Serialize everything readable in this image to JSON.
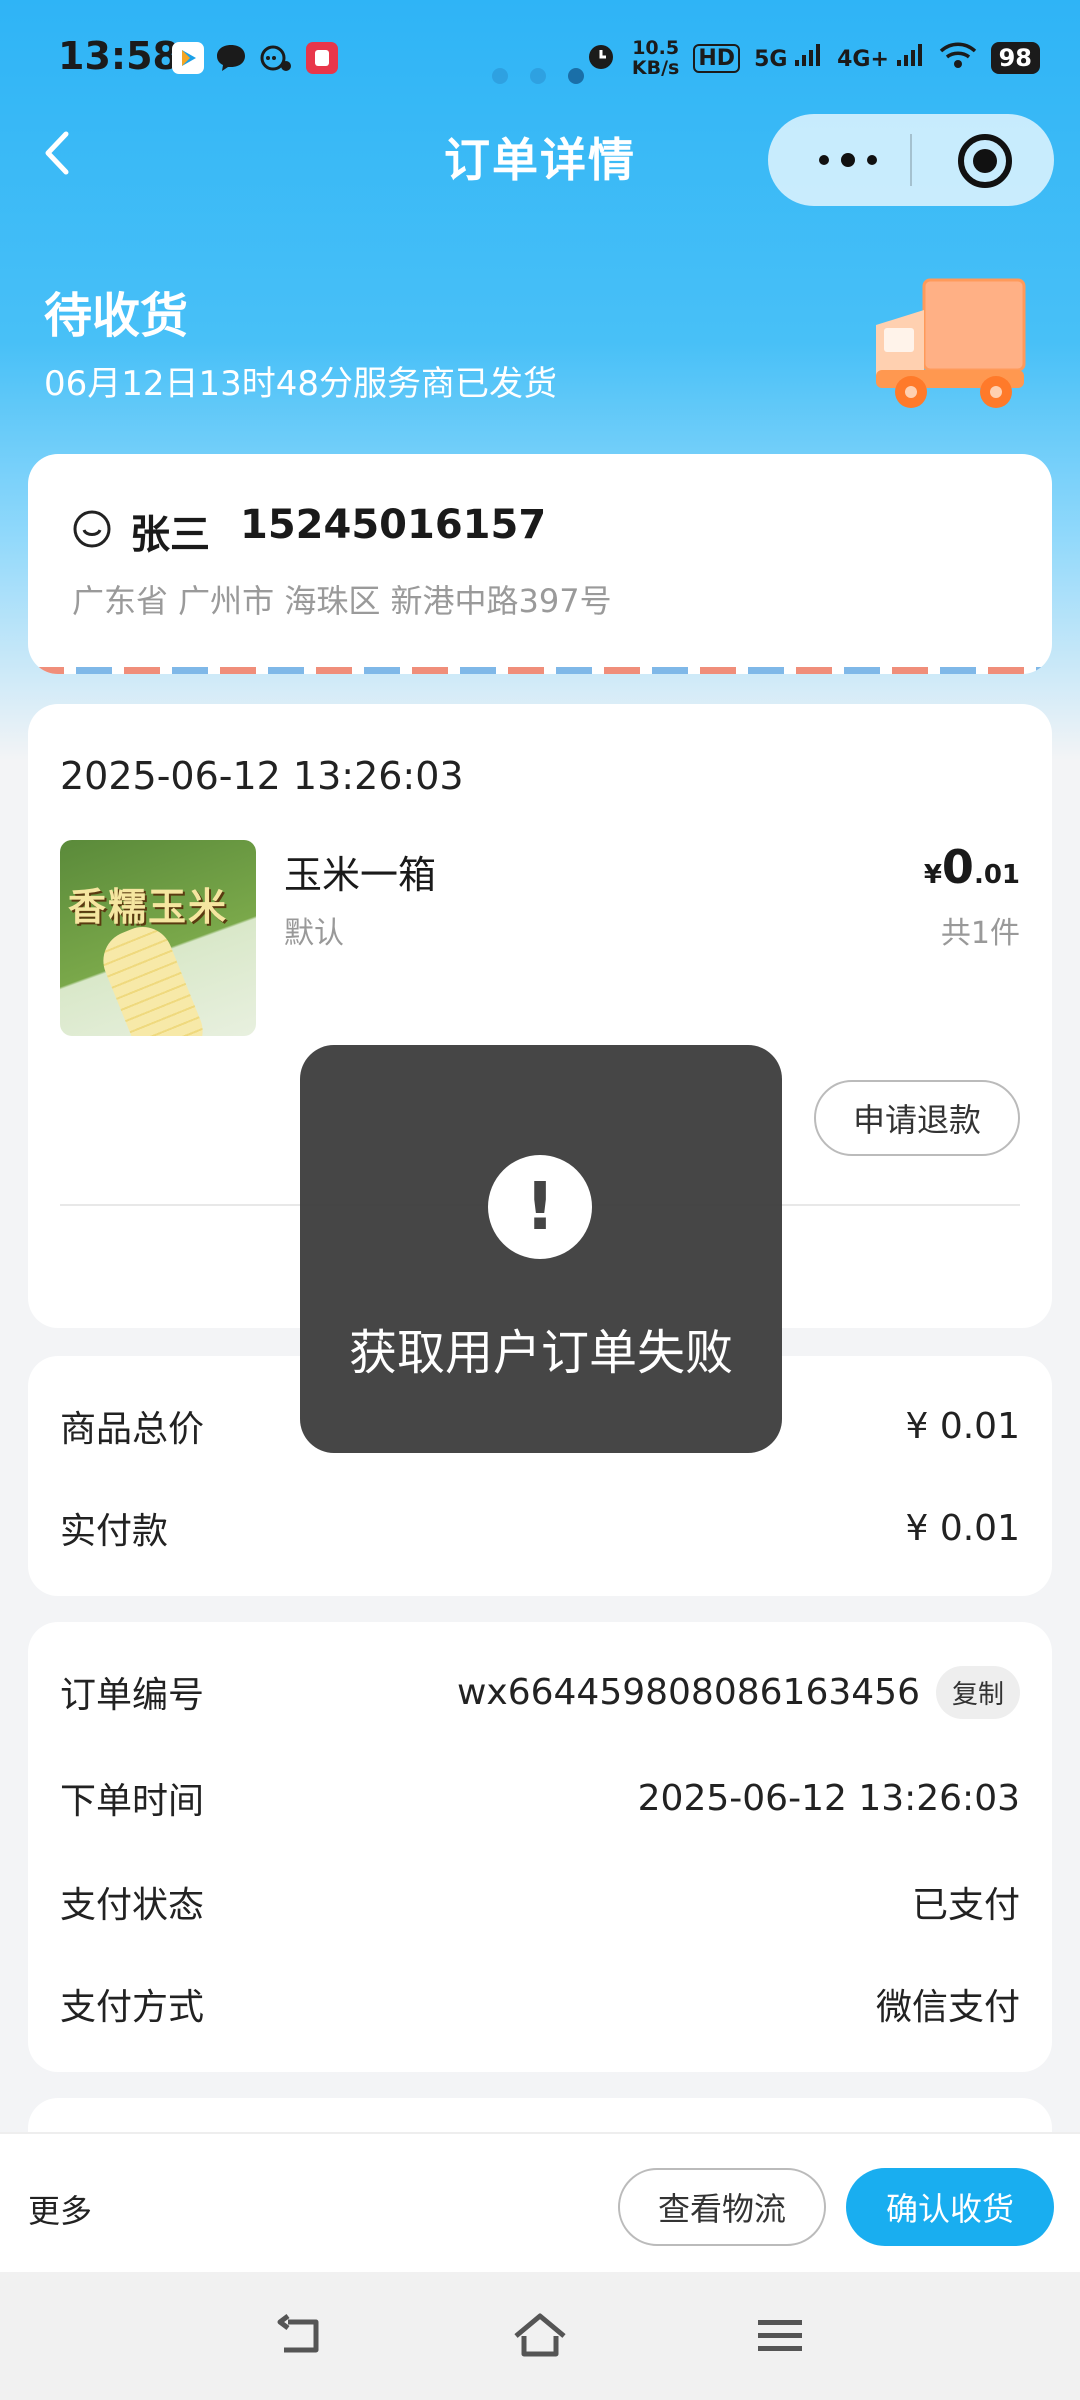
{
  "status_bar": {
    "time": "13:58",
    "net_speed_value": "10.5",
    "net_speed_unit": "KB/s",
    "hd_label": "HD",
    "signal_5g": "5G",
    "signal_4g": "4G+",
    "battery": "98"
  },
  "nav": {
    "title": "订单详情"
  },
  "order_status": {
    "title": "待收货",
    "subtitle": "06月12日13时48分服务商已发货"
  },
  "address": {
    "name": "张三",
    "phone": "15245016157",
    "detail": "广东省 广州市 海珠区 新港中路397号"
  },
  "goods": {
    "order_time": "2025-06-12 13:26:03",
    "image_text": "香糯玉米",
    "name": "玉米一箱",
    "spec": "默认",
    "price_symbol": "¥",
    "price_int": "0",
    "price_dec": ".01",
    "quantity": "共1件",
    "refund_label": "申请退款"
  },
  "price_summary": {
    "rows": [
      {
        "label": "商品总价",
        "value": "¥ 0.01"
      },
      {
        "label": "实付款",
        "value": "¥ 0.01"
      }
    ]
  },
  "order_info": {
    "order_no_label": "订单编号",
    "order_no": "wx664459808086163456",
    "copy_label": "复制",
    "rows": [
      {
        "label": "下单时间",
        "value": "2025-06-12 13:26:03"
      },
      {
        "label": "支付状态",
        "value": "已支付"
      },
      {
        "label": "支付方式",
        "value": "微信支付"
      }
    ]
  },
  "bottom_bar": {
    "more": "更多",
    "logistics": "查看物流",
    "confirm": "确认收货"
  },
  "toast": {
    "icon_text": "!",
    "message": "获取用户订单失败"
  },
  "colors": {
    "accent": "#19aef0",
    "header": "#2fb4f6"
  }
}
